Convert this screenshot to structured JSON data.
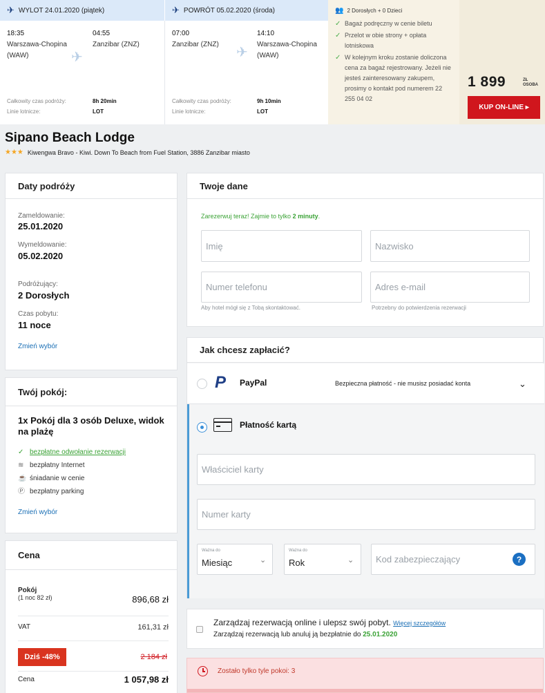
{
  "flight": {
    "outbound": {
      "header": "WYLOT 24.01.2020 (piątek)",
      "dep_time": "18:35",
      "dep_place": "Warszawa-Chopina (WAW)",
      "arr_time": "04:55",
      "arr_place": "Zanzibar (ZNZ)",
      "duration_label": "Całkowity czas podróży:",
      "duration": "8h 20min",
      "airline_label": "Linie lotnicze:",
      "airline": "LOT"
    },
    "return": {
      "header": "POWRÓT 05.02.2020 (środa)",
      "dep_time": "07:00",
      "dep_place": "Zanzibar (ZNZ)",
      "arr_time": "14:10",
      "arr_place": "Warszawa-Chopina (WAW)",
      "duration_label": "Całkowity czas podróży:",
      "duration": "9h 10min",
      "airline_label": "Linie lotnicze:",
      "airline": "LOT"
    },
    "passengers": "2 Dorosłych + 0 Dzieci",
    "benefits": [
      "Bagaż podręczny w cenie biletu",
      "Przelot w obie strony + opłata lotniskowa",
      "W kolejnym kroku zostanie doliczona cena za bagaż rejestrowany. Jeżeli nie jesteś zainteresowany zakupem, prosimy o kontakt pod numerem 22 255 04 02"
    ],
    "price": "1 899",
    "price_unit_1": "ZŁ",
    "price_unit_2": "OSOBA",
    "buy_button": "KUP ON-LINE ▸"
  },
  "hotel": {
    "name": "Sipano Beach Lodge",
    "stars": "★★★",
    "address": "Kiwengwa Bravo - Kiwi. Down To Beach from Fuel Station, 3886 Zanzibar miasto"
  },
  "trip": {
    "title": "Daty podróży",
    "checkin_label": "Zameldowanie:",
    "checkin": "25.01.2020",
    "checkout_label": "Wymeldowanie:",
    "checkout": "05.02.2020",
    "travelers_label": "Podróżujący:",
    "travelers": "2 Dorosłych",
    "stay_label": "Czas pobytu:",
    "stay": "11 noce",
    "change_link": "Zmień wybór"
  },
  "room": {
    "title": "Twój pokój:",
    "name": "1x Pokój dla 3 osób Deluxe, widok na plażę",
    "features": [
      {
        "icon": "check-icon",
        "text": "bezpłatne odwołanie rezerwacji"
      },
      {
        "icon": "wifi-icon",
        "text": "bezpłatny Internet"
      },
      {
        "icon": "breakfast-icon",
        "text": "śniadanie w cenie"
      },
      {
        "icon": "parking-icon",
        "text": "bezpłatny parking"
      }
    ],
    "change_link": "Zmień wybór"
  },
  "price": {
    "title": "Cena",
    "room_label": "Pokój",
    "room_sub": "(1 noc 82 zł)",
    "room_value": "896,68 zł",
    "vat_label": "VAT",
    "vat_value": "161,31 zł",
    "discount_badge": "Dziś -48%",
    "old_price": "2 184 zł",
    "total_label": "Cena",
    "total_value": "1 057,98 zł"
  },
  "form": {
    "title": "Twoje dane",
    "promo_prefix": "Zarezerwuj teraz! Zajmie to tylko",
    "promo_bold": "2 minuty",
    "first_name_ph": "Imię",
    "last_name_ph": "Nazwisko",
    "phone_ph": "Numer telefonu",
    "email_ph": "Adres e-mail",
    "phone_hint": "Aby hotel mógł się z Tobą skontaktować.",
    "email_hint": "Potrzebny do potwierdzenia rezerwacji"
  },
  "payment": {
    "title": "Jak chcesz zapłacić?",
    "paypal_label": "PayPal",
    "paypal_note": "Bezpieczna płatność - nie musisz posiadać konta",
    "card_label": "Płatność kartą",
    "card_owner_ph": "Właściciel karty",
    "card_number_ph": "Numer karty",
    "valid_label": "Ważna do",
    "month_value": "Miesiąc",
    "year_value": "Rok",
    "cvc_ph": "Kod zabezpieczający",
    "help": "?"
  },
  "manage": {
    "title": "Zarządzaj rezerwacją online i ulepsz swój pobyt.",
    "more_link": "Więcej szczegółów",
    "sub_prefix": "Zarządzaj rezerwacją lub anuluj ją bezpłatnie do",
    "sub_date": "25.01.2020"
  },
  "alert": {
    "text": "Zostało tylko tyle pokoi: 3"
  },
  "colors": {
    "accent_blue": "#1a6fb5",
    "buy_red": "#d0161d",
    "green": "#3aa235",
    "alert_bg": "#fbe0e1"
  }
}
